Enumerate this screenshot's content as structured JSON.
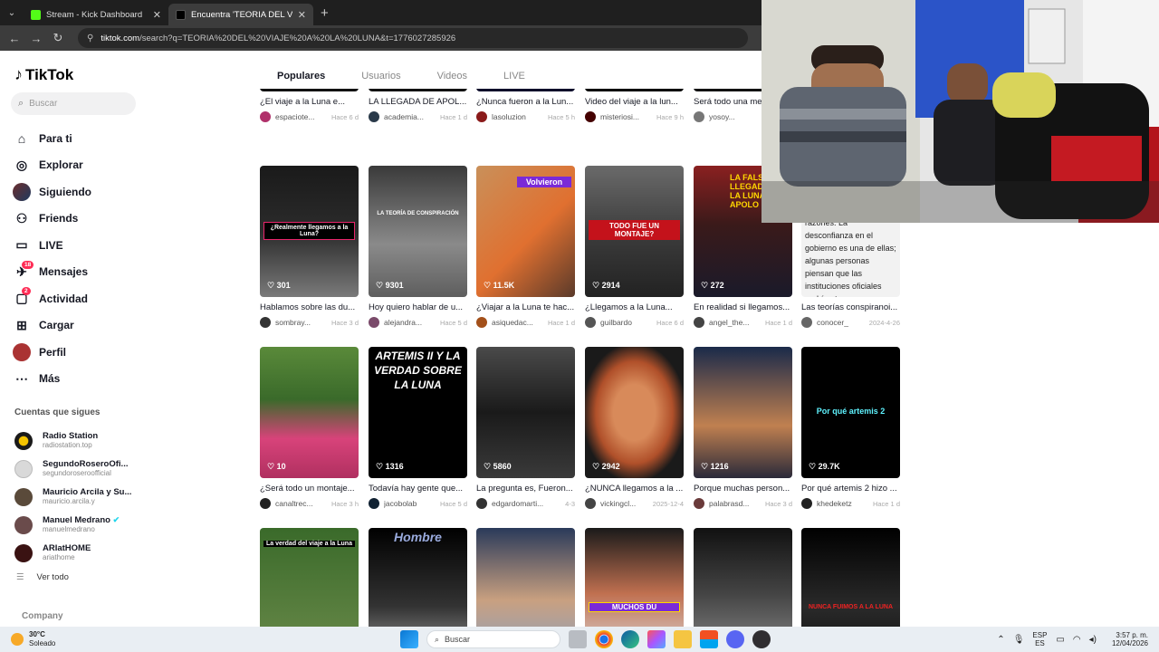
{
  "browser": {
    "tabs": [
      {
        "title": "Stream - Kick Dashboard",
        "active": false,
        "favicon_color": "#53fc18"
      },
      {
        "title": "Encuentra 'TEORIA DEL VIAJE A",
        "active": true,
        "favicon_color": "#000000"
      }
    ],
    "url_host": "tiktok.com",
    "url_path": "/search?q=TEORIA%20DEL%20VIAJE%20A%20LA%20LUNA&t=1776027285926"
  },
  "sidebar": {
    "logo": "TikTok",
    "search_placeholder": "Buscar",
    "menu": [
      {
        "label": "Para ti",
        "icon": "home-icon"
      },
      {
        "label": "Explorar",
        "icon": "compass-icon"
      },
      {
        "label": "Siguiendo",
        "icon": "avatar-icon"
      },
      {
        "label": "Friends",
        "icon": "friends-icon"
      },
      {
        "label": "LIVE",
        "icon": "live-icon"
      },
      {
        "label": "Mensajes",
        "icon": "message-icon",
        "badge": "18"
      },
      {
        "label": "Actividad",
        "icon": "activity-icon",
        "badge": "2"
      },
      {
        "label": "Cargar",
        "icon": "upload-icon"
      },
      {
        "label": "Perfil",
        "icon": "profile-icon"
      },
      {
        "label": "Más",
        "icon": "more-icon"
      }
    ],
    "following_title": "Cuentas que sigues",
    "following": [
      {
        "name": "Radio Station",
        "handle": "radiostation.top",
        "verified": false
      },
      {
        "name": "SegundoRoseroOfi...",
        "handle": "segundoroseroofficial",
        "verified": false
      },
      {
        "name": "Mauricio Arcila y Su...",
        "handle": "mauricio.arcila.y",
        "verified": false
      },
      {
        "name": "Manuel Medrano",
        "handle": "manuelmedrano",
        "verified": true
      },
      {
        "name": "ARIatHOME",
        "handle": "ariathome",
        "verified": false
      }
    ],
    "see_all": "Ver todo",
    "company": "Company"
  },
  "search_tabs": [
    "Populares",
    "Usuarios",
    "Videos",
    "LIVE"
  ],
  "row0": [
    {
      "caption": "¿El viaje a la Luna e...",
      "user": "espaciote...",
      "when": "Hace 6 d"
    },
    {
      "caption": "LA LLEGADA DE APOL...",
      "user": "academia...",
      "when": "Hace 1 d"
    },
    {
      "caption": "¿Nunca fueron a la Lun...",
      "user": "lasoluzion",
      "when": "Hace 5 h"
    },
    {
      "caption": "Video del viaje a la lun...",
      "user": "misteriosi...",
      "when": "Hace 9 h"
    },
    {
      "caption": "Será todo una me",
      "user": "yosoy...",
      "when": ""
    }
  ],
  "row1": [
    {
      "caption": "Hablamos sobre las du...",
      "user": "sombray...",
      "when": "Hace 3 d",
      "views": "301",
      "overlay": "¿Realmente llegamos a la Luna?"
    },
    {
      "caption": "Hoy quiero hablar de u...",
      "user": "alejandra...",
      "when": "Hace 5 d",
      "views": "9301",
      "overlay": "LA TEORÍA DE CONSPIRACIÓN"
    },
    {
      "caption": "¿Viajar a la Luna te hac...",
      "user": "asiquedac...",
      "when": "Hace 1 d",
      "views": "11.5K",
      "overlay": "Volvieron"
    },
    {
      "caption": "¿Llegamos a la Luna...",
      "user": "guilbardo",
      "when": "Hace 6 d",
      "views": "2914",
      "overlay": "TODO FUE UN MONTAJE?"
    },
    {
      "caption": "En realidad si llegamos...",
      "user": "angel_the...",
      "when": "Hace 1 d",
      "views": "272",
      "overlay": "LA FALSA LLEGADA A LA LUNA APOLO 11"
    },
    {
      "caption": "Las teorías conspiranoi...",
      "user": "conocer_",
      "when": "2024-4-26",
      "views": "",
      "overlay": "razones. La desconfianza en el gobierno es una de ellas; algunas personas piensan que las instituciones oficiales podrían tener razones"
    }
  ],
  "row2": [
    {
      "caption": "¿Será todo un montaje...",
      "user": "canaltrec...",
      "when": "Hace 3 h",
      "views": "10",
      "overlay": ""
    },
    {
      "caption": "Todavía hay gente que...",
      "user": "jacobolab",
      "when": "Hace 5 d",
      "views": "1316",
      "overlay": "ARTEMIS II Y LA VERDAD SOBRE LA LUNA"
    },
    {
      "caption": "La pregunta es, Fueron...",
      "user": "edgardomarti...",
      "when": "4-3",
      "views": "5860",
      "overlay": ""
    },
    {
      "caption": "¿NUNCA llegamos a la ...",
      "user": "vickingcl...",
      "when": "2025-12-4",
      "views": "2942",
      "overlay": ""
    },
    {
      "caption": "Porque muchas person...",
      "user": "palabrasd...",
      "when": "Hace 3 d",
      "views": "1216",
      "overlay": ""
    },
    {
      "caption": "Por qué artemis 2 hizo ...",
      "user": "khedeketz",
      "when": "Hace 1 d",
      "views": "29.7K",
      "overlay": "Por qué artemis 2"
    }
  ],
  "row3": [
    {
      "overlay": "La verdad del viaje a la Luna"
    },
    {
      "overlay": "Hombre"
    },
    {
      "overlay": ""
    },
    {
      "overlay": "MUCHOS DU"
    },
    {
      "overlay": ""
    },
    {
      "overlay": "NUNCA FUIMOS A LA LUNA"
    }
  ],
  "taskbar": {
    "temp": "30°C",
    "weather": "Soleado",
    "search": "Buscar",
    "lang1": "ESP",
    "lang2": "ES",
    "time": "3:57 p. m.",
    "date": "12/04/2026"
  }
}
